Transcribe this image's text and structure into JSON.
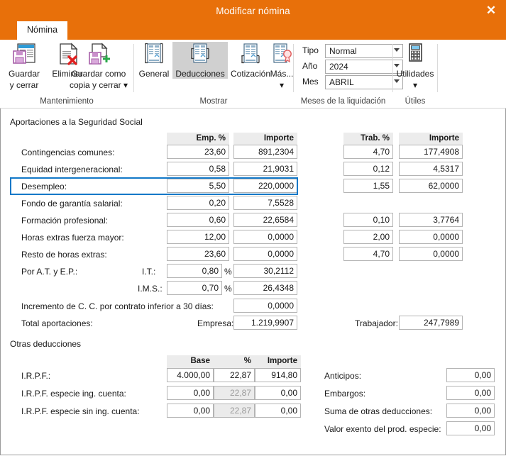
{
  "window": {
    "title": "Modificar nómina",
    "close_label": "✕",
    "accent_color": "#e8700a",
    "focus_color": "#1278c8"
  },
  "tabs": [
    {
      "label": "Nómina",
      "active": true
    }
  ],
  "ribbon": {
    "groups": [
      {
        "label": "Mantenimiento"
      },
      {
        "label": "Mostrar"
      },
      {
        "label": "Meses de la liquidación"
      },
      {
        "label": "Útiles"
      }
    ],
    "maintenance_buttons": [
      {
        "label_line1": "Guardar",
        "label_line2": "y cerrar",
        "icon": "save-and-close-icon"
      },
      {
        "label_line1": "Eliminar",
        "label_line2": "",
        "icon": "delete-document-icon"
      },
      {
        "label_line1": "Guardar como",
        "label_line2": "copia y cerrar ▾",
        "icon": "save-as-copy-icon"
      }
    ],
    "show_buttons": [
      {
        "label": "General",
        "icon": "document-general-icon",
        "selected": false
      },
      {
        "label": "Deducciones",
        "icon": "document-deductions-icon",
        "selected": true
      },
      {
        "label": "Cotización",
        "icon": "document-quote-icon",
        "selected": false
      },
      {
        "label": "Más...",
        "icon": "document-more-seal-icon",
        "selected": false,
        "caret": "▾"
      }
    ],
    "liquidation": [
      {
        "label": "Tipo",
        "value": "Normal"
      },
      {
        "label": "Año",
        "value": "2024"
      },
      {
        "label": "Mes",
        "value": "ABRIL"
      }
    ],
    "utilities": {
      "label": "Utilidades",
      "icon": "calculator-icon",
      "caret": "▾"
    }
  },
  "social_security": {
    "section_title": "Aportaciones a la Seguridad Social",
    "headers": {
      "emp_pct": "Emp. %",
      "emp_importe": "Importe",
      "trab_pct": "Trab. %",
      "trab_importe": "Importe"
    },
    "rows": [
      {
        "label": "Contingencias comunes:",
        "emp_pct": "23,60",
        "emp_importe": "891,2304",
        "trab_pct": "4,70",
        "trab_importe": "177,4908"
      },
      {
        "label": "Equidad intergeneracional:",
        "emp_pct": "0,58",
        "emp_importe": "21,9031",
        "trab_pct": "0,12",
        "trab_importe": "4,5317"
      },
      {
        "label": "Desempleo:",
        "emp_pct": "5,50",
        "emp_importe": "220,0000",
        "trab_pct": "1,55",
        "trab_importe": "62,0000",
        "focused": true
      },
      {
        "label": "Fondo de garantía salarial:",
        "emp_pct": "0,20",
        "emp_importe": "7,5528",
        "trab_pct": null,
        "trab_importe": null
      },
      {
        "label": "Formación profesional:",
        "emp_pct": "0,60",
        "emp_importe": "22,6584",
        "trab_pct": "0,10",
        "trab_importe": "3,7764"
      },
      {
        "label": "Horas extras fuerza mayor:",
        "emp_pct": "12,00",
        "emp_importe": "0,0000",
        "trab_pct": "2,00",
        "trab_importe": "0,0000"
      },
      {
        "label": "Resto de horas extras:",
        "emp_pct": "23,60",
        "emp_importe": "0,0000",
        "trab_pct": "4,70",
        "trab_importe": "0,0000"
      }
    ],
    "at_ep": {
      "label": "Por A.T. y E.P.:",
      "sub": [
        {
          "label": "I.T.:",
          "pct": "0,80",
          "pct_sign": "%",
          "importe": "30,2112"
        },
        {
          "label": "I.M.S.:",
          "pct": "0,70",
          "pct_sign": "%",
          "importe": "26,4348"
        }
      ]
    },
    "increment": {
      "label": "Incremento de C. C. por contrato inferior a 30 días:",
      "value": "0,0000"
    },
    "totals": {
      "label": "Total aportaciones:",
      "company_label": "Empresa:",
      "company_value": "1.219,9907",
      "worker_label": "Trabajador:",
      "worker_value": "247,7989"
    }
  },
  "other_deductions": {
    "section_title": "Otras deducciones",
    "headers": {
      "base": "Base",
      "pct": "%",
      "importe": "Importe"
    },
    "rows": [
      {
        "label": "I.R.P.F.:",
        "base": "4.000,00",
        "pct": "22,87",
        "importe": "914,80",
        "pct_disabled": false
      },
      {
        "label": "I.R.P.F. especie ing. cuenta:",
        "base": "0,00",
        "pct": "22,87",
        "importe": "0,00",
        "pct_disabled": true
      },
      {
        "label": "I.R.P.F. especie sin ing. cuenta:",
        "base": "0,00",
        "pct": "22,87",
        "importe": "0,00",
        "pct_disabled": true
      }
    ],
    "right_fields": [
      {
        "label": "Anticipos:",
        "value": "0,00"
      },
      {
        "label": "Embargos:",
        "value": "0,00"
      },
      {
        "label": "Suma de otras deducciones:",
        "value": "0,00"
      },
      {
        "label": "Valor exento del prod. especie:",
        "value": "0,00"
      }
    ]
  }
}
